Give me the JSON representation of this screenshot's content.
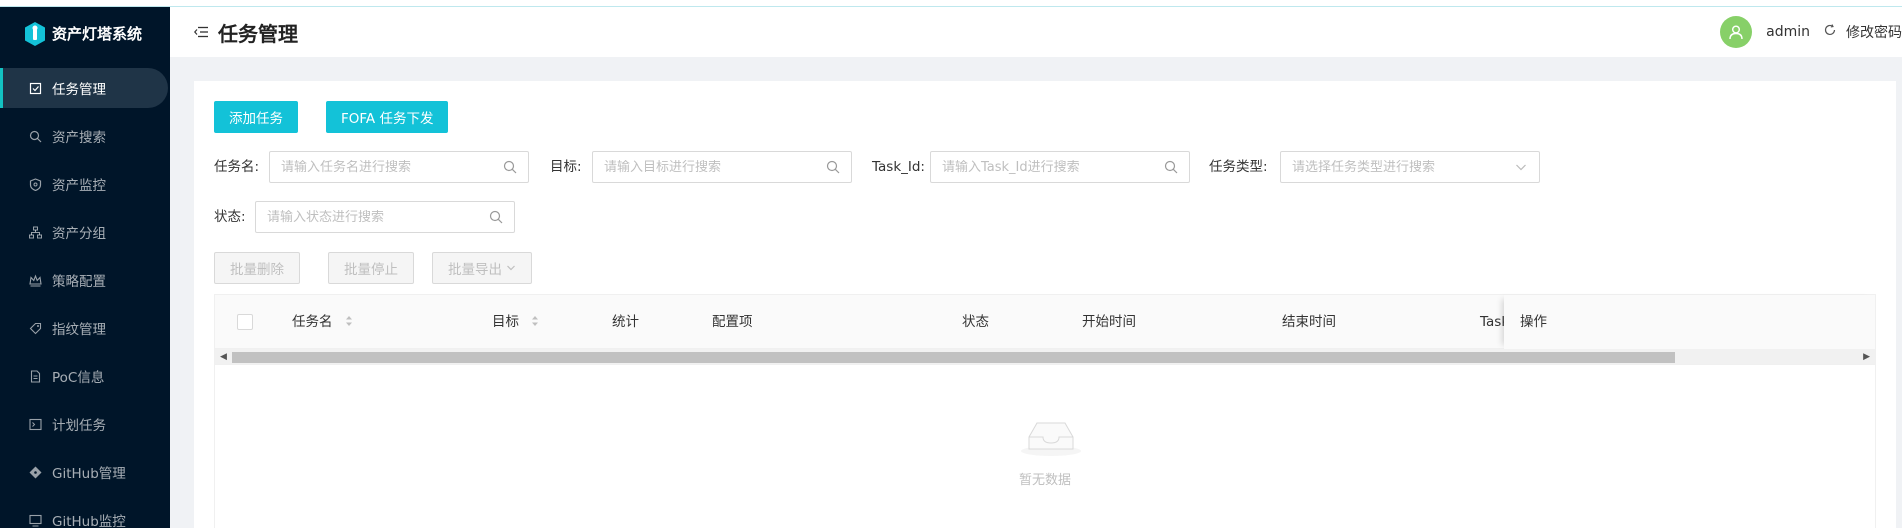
{
  "app": {
    "title": "资产灯塔系统"
  },
  "sidebar": {
    "items": [
      {
        "label": "任务管理",
        "icon": "task-icon",
        "active": true
      },
      {
        "label": "资产搜索",
        "icon": "search-icon",
        "active": false
      },
      {
        "label": "资产监控",
        "icon": "shield-icon",
        "active": false
      },
      {
        "label": "资产分组",
        "icon": "cluster-icon",
        "active": false
      },
      {
        "label": "策略配置",
        "icon": "crown-icon",
        "active": false
      },
      {
        "label": "指纹管理",
        "icon": "tag-icon",
        "active": false
      },
      {
        "label": "PoC信息",
        "icon": "file-icon",
        "active": false
      },
      {
        "label": "计划任务",
        "icon": "terminal-icon",
        "active": false
      },
      {
        "label": "GitHub管理",
        "icon": "git-icon",
        "active": false
      },
      {
        "label": "GitHub监控",
        "icon": "monitor-icon",
        "active": false
      }
    ]
  },
  "header": {
    "page_title": "任务管理",
    "username": "admin",
    "change_password": "修改密码"
  },
  "toolbar": {
    "add_task": "添加任务",
    "fofa_task": "FOFA 任务下发",
    "batch_delete": "批量删除",
    "batch_stop": "批量停止",
    "batch_export": "批量导出"
  },
  "filters": {
    "task_name": {
      "label": "任务名:",
      "placeholder": "请输入任务名进行搜索"
    },
    "target": {
      "label": "目标:",
      "placeholder": "请输入目标进行搜索"
    },
    "task_id": {
      "label": "Task_Id:",
      "placeholder": "请输入Task_Id进行搜索"
    },
    "task_type": {
      "label": "任务类型:",
      "placeholder": "请选择任务类型进行搜索"
    },
    "status": {
      "label": "状态:",
      "placeholder": "请输入状态进行搜索"
    }
  },
  "table": {
    "columns": [
      "任务名",
      "目标",
      "统计",
      "配置项",
      "状态",
      "开始时间",
      "结束时间",
      "Task",
      "操作"
    ],
    "rows": [],
    "empty_text": "暂无数据"
  },
  "colors": {
    "sidebar_bg": "#001529",
    "accent": "#13c2d8",
    "avatar": "#87d068"
  }
}
